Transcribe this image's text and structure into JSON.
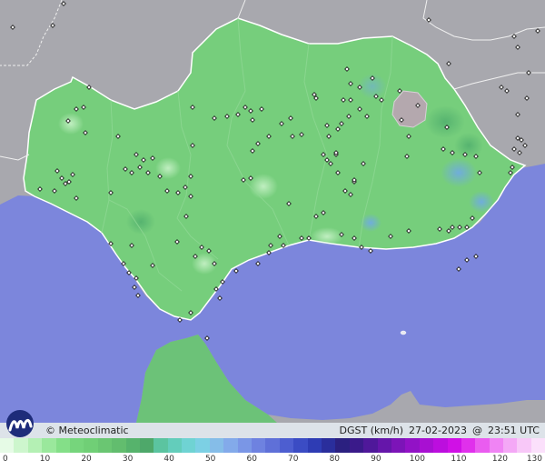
{
  "credit": "© Meteoclimatic",
  "variable": "DGST (km/h)",
  "date": "27-02-2023",
  "at": "@",
  "time": "23:51 UTC",
  "colors": {
    "sea": "#7c86dc",
    "land_outside": "#a8a8ae",
    "region_fill": "#76ce7c",
    "border": "#ffffff"
  },
  "legend": {
    "ticks": [
      "0",
      "10",
      "20",
      "30",
      "40",
      "50",
      "60",
      "70",
      "80",
      "90",
      "100",
      "110",
      "120",
      "130"
    ],
    "colors": [
      "#e6fbe6",
      "#cdf6cd",
      "#b4f0b4",
      "#9ae89c",
      "#84df88",
      "#76d57c",
      "#70cf76",
      "#6ac672",
      "#62bd6e",
      "#56b36c",
      "#4ea86a",
      "#5bc4a0",
      "#63cdbb",
      "#6fd3d3",
      "#7cd0e4",
      "#85bde8",
      "#83aaea",
      "#7a96e6",
      "#6e82e0",
      "#5f70d8",
      "#4d5ed0",
      "#3b4cc4",
      "#2e3cb4",
      "#2a2e9c",
      "#2b2080",
      "#3a1a8a",
      "#4f189a",
      "#6516aa",
      "#7c14b8",
      "#9212c6",
      "#a810d2",
      "#bc0ede",
      "#d010e6",
      "#e030ec",
      "#ea5cf0",
      "#f084f4",
      "#f4a8f6",
      "#f8c8f8",
      "#fbe0fb"
    ]
  }
}
